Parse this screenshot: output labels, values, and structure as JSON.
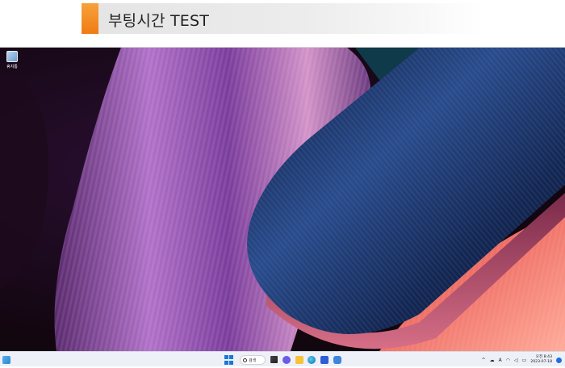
{
  "heading": {
    "title": "부팅시간 TEST",
    "accent_color": "#ef7b14"
  },
  "desktop": {
    "icons": [
      {
        "label": "휴지통",
        "icon": "recycle-bin-icon"
      }
    ]
  },
  "taskbar": {
    "search_label": "검색",
    "apps": [
      {
        "name": "task-view",
        "icon": "task-view-icon"
      },
      {
        "name": "chat",
        "icon": "chat-icon"
      },
      {
        "name": "file-explorer",
        "icon": "folder-icon"
      },
      {
        "name": "edge",
        "icon": "edge-icon"
      },
      {
        "name": "store",
        "icon": "store-icon"
      },
      {
        "name": "settings",
        "icon": "gear-icon"
      }
    ],
    "tray": {
      "chevron": "^",
      "ime": "A",
      "time": "오전 8:43",
      "date": "2023-07-18"
    }
  }
}
